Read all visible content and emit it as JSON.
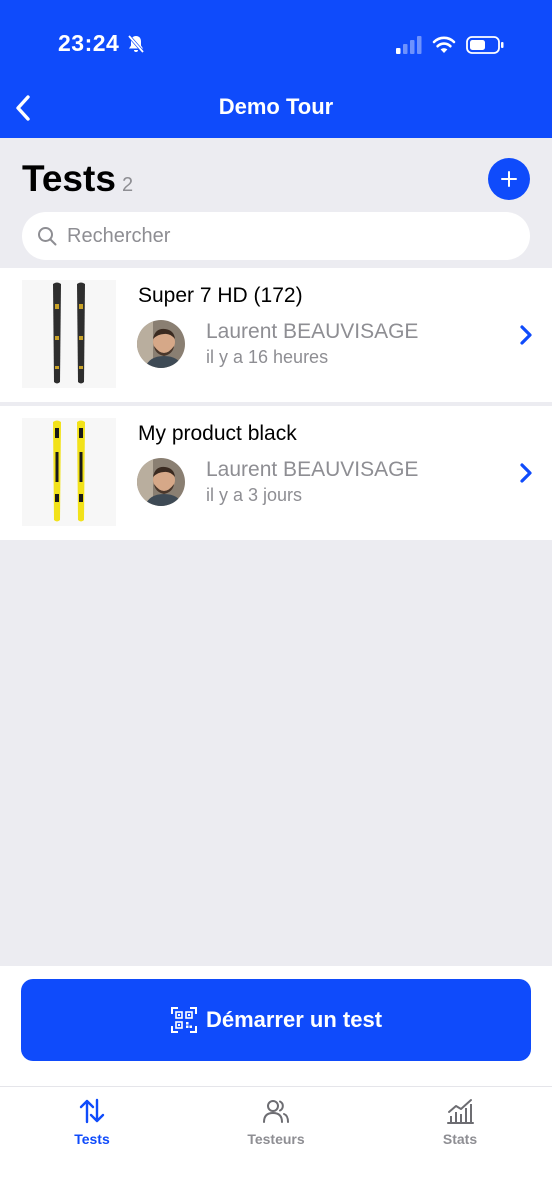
{
  "status_bar": {
    "time": "23:24"
  },
  "nav": {
    "title": "Demo Tour"
  },
  "header": {
    "title": "Tests",
    "count": "2"
  },
  "search": {
    "placeholder": "Rechercher"
  },
  "tests": [
    {
      "product": "Super 7 HD (172)",
      "tester": "Laurent BEAUVISAGE",
      "time": "il y a 16 heures",
      "ski_color": "#2E2E2E",
      "accent_color": "#C9A227"
    },
    {
      "product": "My product black",
      "tester": "Laurent BEAUVISAGE",
      "time": "il y a 3 jours",
      "ski_color": "#F2E21A",
      "accent_color": "#1A1A1A"
    }
  ],
  "cta": {
    "label": "Démarrer un test"
  },
  "tabs": [
    {
      "label": "Tests",
      "icon": "sort-arrows-icon",
      "active": true
    },
    {
      "label": "Testeurs",
      "icon": "users-icon",
      "active": false
    },
    {
      "label": "Stats",
      "icon": "chart-icon",
      "active": false
    }
  ],
  "colors": {
    "brand": "#0F4BFB",
    "muted_text": "#8E8E93",
    "background": "#ECECF1"
  }
}
